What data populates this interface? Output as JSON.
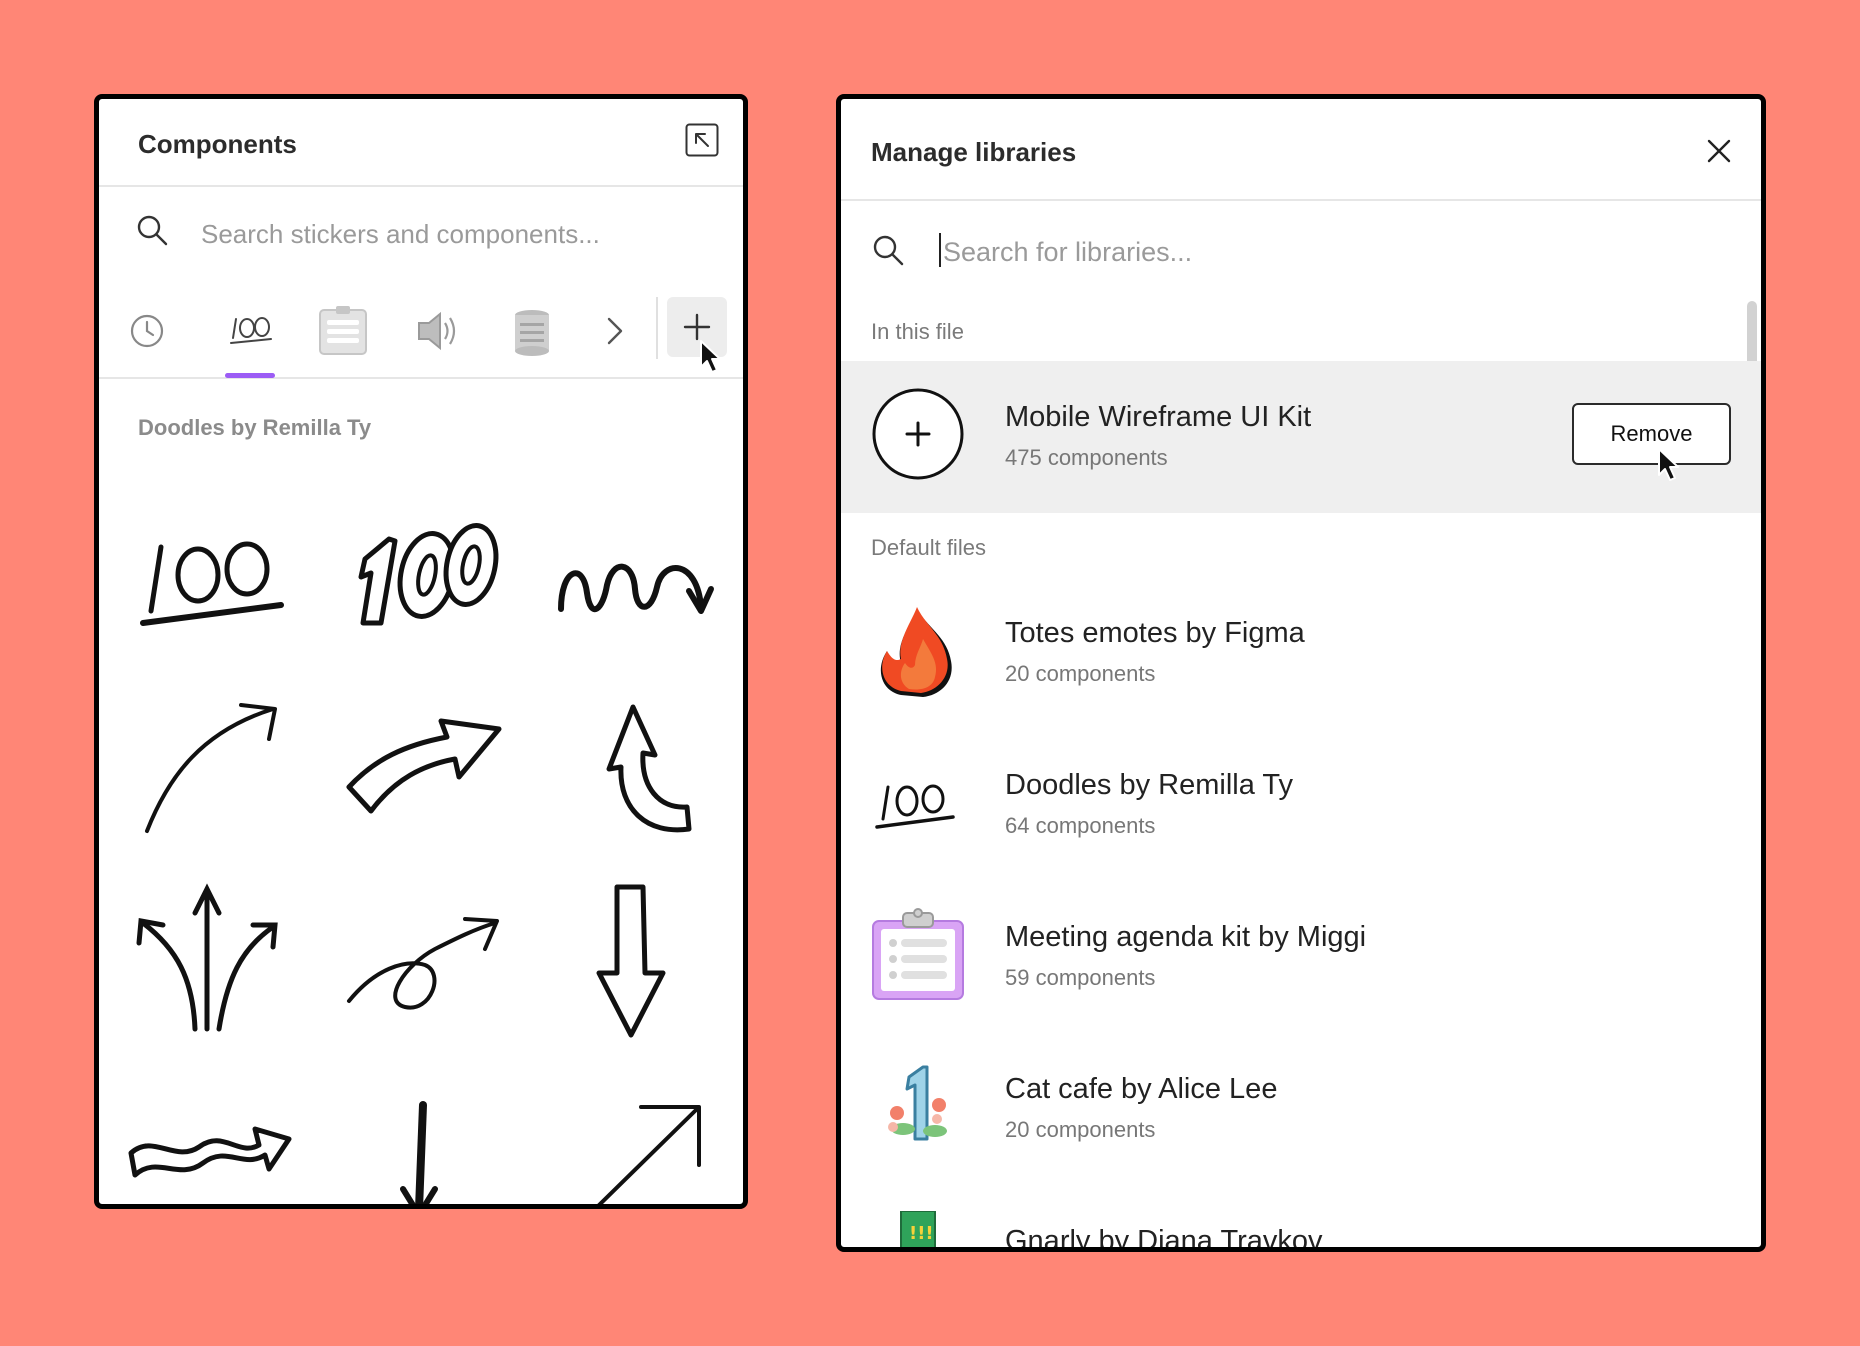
{
  "components_panel": {
    "title": "Components",
    "search_placeholder": "Search stickers and components...",
    "tabs": [
      {
        "name": "recent",
        "icon": "clock-icon"
      },
      {
        "name": "doodles",
        "icon": "hundred-doodle-icon",
        "active": true
      },
      {
        "name": "meeting-agenda",
        "icon": "clipboard-icon"
      },
      {
        "name": "sound",
        "icon": "speaker-icon"
      },
      {
        "name": "sticker-text",
        "icon": "stamp-text-icon"
      }
    ],
    "section_label": "Doodles by Remilla Ty",
    "accent_color": "#9C5CF5"
  },
  "libraries_panel": {
    "title": "Manage libraries",
    "search_placeholder": "Search for libraries...",
    "in_this_file_label": "In this file",
    "default_files_label": "Default files",
    "current_library": {
      "name": "Mobile Wireframe UI Kit",
      "count": "475 components",
      "remove_label": "Remove"
    },
    "libraries": [
      {
        "name": "Totes emotes by Figma",
        "count": "20 components",
        "icon": "fire-icon"
      },
      {
        "name": "Doodles by Remilla Ty",
        "count": "64 components",
        "icon": "hundred-doodle-icon"
      },
      {
        "name": "Meeting agenda kit by Miggi",
        "count": "59 components",
        "icon": "clipboard-icon"
      },
      {
        "name": "Cat cafe by Alice Lee",
        "count": "20 components",
        "icon": "number-one-flowers-icon"
      },
      {
        "name": "Gnarly by Diana Travkov",
        "count": "",
        "icon": "flag-icon"
      }
    ]
  },
  "colors": {
    "background": "#FF8676",
    "accent": "#9C5CF5",
    "selected_row": "#efefef"
  }
}
